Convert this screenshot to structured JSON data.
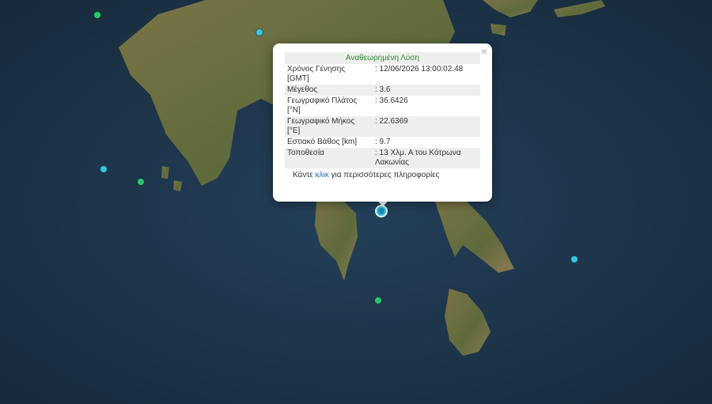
{
  "popup": {
    "title": "Αναθεωρημένη Λύση",
    "close_symbol": "×",
    "rows": [
      {
        "label": "Χρόνος Γένησης [GMT]",
        "value": ": 12/06/2026 13:00:02.48"
      },
      {
        "label": "Μέγεθος",
        "value": ": 3.6"
      },
      {
        "label": "Γεωγραφικό Πλάτος [°N]",
        "value": ": 36.6426"
      },
      {
        "label": "Γεωγραφικό Μήκος [°E]",
        "value": ": 22.6369"
      },
      {
        "label": "Εστιακό Βάθος [km]",
        "value": ": 9.7"
      },
      {
        "label": "Τοποθεσία",
        "value": ": 13 Χλμ. Α του Κότρωνα Λακωνίας"
      }
    ],
    "more_prefix": "Κάντε ",
    "more_link": "κλικ",
    "more_suffix": " για περισσότερες πληροφορίες"
  },
  "colors": {
    "sea": "#1d3347",
    "land": "#6b6a3e",
    "marker_green": "#2ec46a",
    "marker_cyan": "#35c7e3",
    "title_green": "#2e8b2e"
  }
}
